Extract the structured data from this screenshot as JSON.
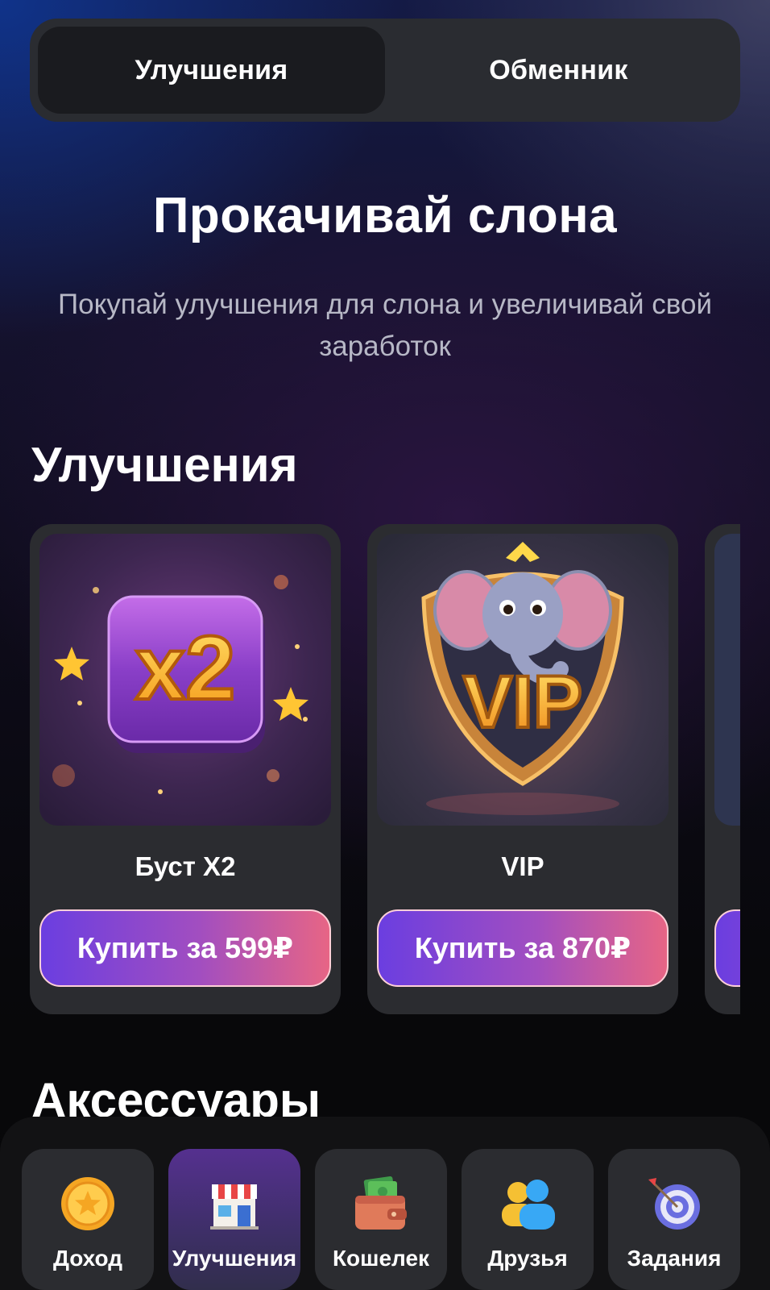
{
  "top_tabs": [
    {
      "label": "Улучшения",
      "active": true
    },
    {
      "label": "Обменник",
      "active": false
    }
  ],
  "hero": {
    "title": "Прокачивай слона",
    "subtitle": "Покупай улучшения для слона и увеличивай свой заработок"
  },
  "sections": {
    "upgrades": "Улучшения",
    "accessories": "Аксессуары"
  },
  "cards": [
    {
      "name": "Буст X2",
      "button": "Купить за 599₽",
      "image_text": "x2"
    },
    {
      "name": "VIP",
      "button": "Купить за 870₽",
      "image_text": "VIP"
    }
  ],
  "bottom_nav": [
    {
      "label": "Доход",
      "icon": "gold-coin-icon",
      "active": false
    },
    {
      "label": "Улучшения",
      "icon": "shop-icon",
      "active": true
    },
    {
      "label": "Кошелек",
      "icon": "wallet-icon",
      "active": false
    },
    {
      "label": "Друзья",
      "icon": "friends-icon",
      "active": false
    },
    {
      "label": "Задания",
      "icon": "target-icon",
      "active": false
    }
  ],
  "colors": {
    "button_gradient_start": "#6b3ee0",
    "button_gradient_end": "#e76585",
    "card_bg": "#2b2c30",
    "active_nav": "#55308f"
  }
}
